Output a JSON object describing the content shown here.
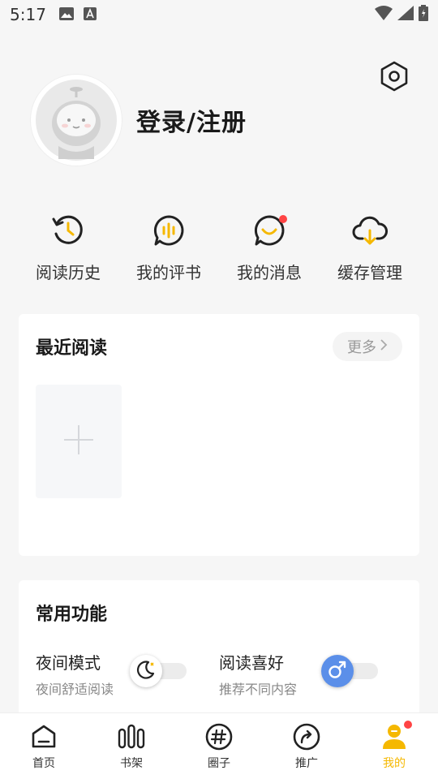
{
  "status_bar": {
    "time": "5:17"
  },
  "profile": {
    "login_label": "登录/注册"
  },
  "quick_actions": [
    {
      "label": "阅读历史",
      "icon": "history-icon"
    },
    {
      "label": "我的评书",
      "icon": "review-icon"
    },
    {
      "label": "我的消息",
      "icon": "message-icon",
      "badge": true
    },
    {
      "label": "缓存管理",
      "icon": "cache-download-icon"
    }
  ],
  "recent": {
    "title": "最近阅读",
    "more_label": "更多"
  },
  "functions": {
    "title": "常用功能",
    "items": [
      {
        "name": "夜间模式",
        "sub": "夜间舒适阅读",
        "enabled": false
      },
      {
        "name": "阅读喜好",
        "sub": "推荐不同内容",
        "enabled": false
      }
    ]
  },
  "tabs": [
    {
      "label": "首页",
      "icon": "home-icon"
    },
    {
      "label": "书架",
      "icon": "bookshelf-icon"
    },
    {
      "label": "圈子",
      "icon": "circle-hash-icon"
    },
    {
      "label": "推广",
      "icon": "share-icon"
    },
    {
      "label": "我的",
      "icon": "profile-icon",
      "active": true
    }
  ],
  "colors": {
    "accent": "#f5b800",
    "badge": "#ff4444",
    "toggle_blue": "#5b8fe9"
  }
}
